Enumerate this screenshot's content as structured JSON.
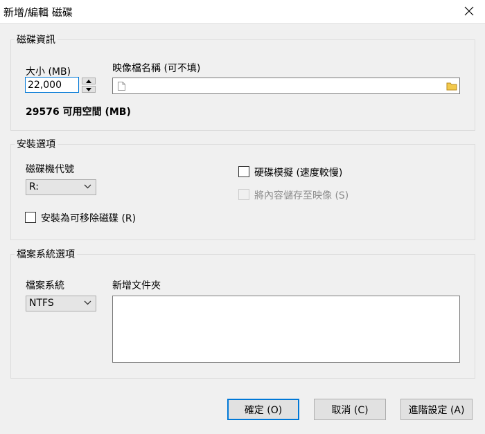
{
  "dialog": {
    "title": "新增/編輯 磁碟"
  },
  "disk_info": {
    "group_label": "磁碟資訊",
    "size_label": "大小 (MB)",
    "size_value": "22,000",
    "image_label": "映像檔名稱 (可不填)",
    "image_value": "",
    "free_space_text": "29576 可用空間 (MB)"
  },
  "install_options": {
    "group_label": "安裝選項",
    "drive_letter_label": "磁碟機代號",
    "drive_letter_value": "R:",
    "removable_label": "安裝為可移除磁碟 (R)",
    "removable_checked": false,
    "hdd_emulation_label": "硬碟模擬 (速度較慢)",
    "hdd_emulation_checked": false,
    "save_to_image_label": "將內容儲存至映像 (S)",
    "save_to_image_enabled": false
  },
  "fs_options": {
    "group_label": "檔案系統選項",
    "fs_label": "檔案系統",
    "fs_value": "NTFS",
    "new_folder_label": "新增文件夾",
    "new_folder_value": ""
  },
  "buttons": {
    "ok": "確定 (O)",
    "cancel": "取消 (C)",
    "advanced": "進階設定 (A)"
  },
  "colors": {
    "accent": "#0078d7",
    "folder": "#f2c94c"
  }
}
